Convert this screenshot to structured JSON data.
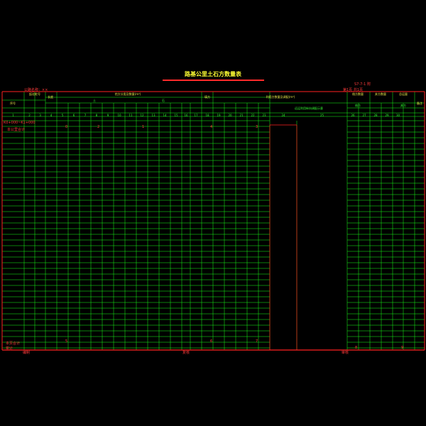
{
  "title": "路基公里土石方数量表",
  "header_right_top": "第1页 共1页",
  "header_right_bottom": "S7-7-1 附",
  "header_left": "公路名称：××",
  "col_heads": {
    "c1": "起讫桩号",
    "c2": "长度",
    "c3": "挖方分类及数量(m³)",
    "c4": "填方",
    "c5": "利用方数量及调配(m³)",
    "c6": "借方数量",
    "c7": "弃方数量",
    "c8": "总运量",
    "c9": "备注",
    "sub_a": "土",
    "sub_b": "石",
    "sub_c": "远运利用纵向调配示意",
    "sub_d": "借方",
    "sub_e": "弃方",
    "row_no": "序号"
  },
  "col_numbers": [
    "1",
    "2",
    "3",
    "4",
    "5",
    "6",
    "7",
    "8",
    "9",
    "10",
    "11",
    "12",
    "13",
    "14",
    "15",
    "16",
    "17",
    "18",
    "19",
    "20",
    "21",
    "22",
    "23",
    "24",
    "25",
    "26",
    "27",
    "28",
    "29",
    "30"
  ],
  "left_labels": {
    "r1": "K0+000~K1+000",
    "r2": "本公里合计",
    "sum1": "本页合计",
    "sum2": "累计"
  },
  "bottom_marks": [
    "编制",
    "复核",
    "审核"
  ],
  "sample_values": {
    "v1": "0",
    "v2": "2",
    "v3": "1",
    "v4": "4",
    "v5": "3",
    "v6": "5",
    "v7": "6",
    "v8": "7",
    "v9": "8",
    "v10": "9"
  },
  "colors": {
    "grid": "#19ff19",
    "frame": "#ff2020",
    "title": "#ffff33",
    "bg": "#000000"
  }
}
